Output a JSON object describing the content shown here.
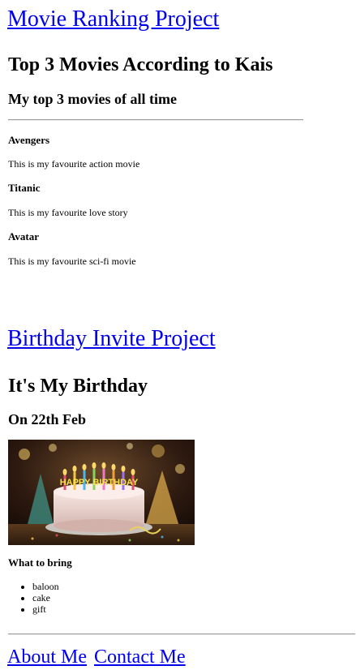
{
  "movie_project": {
    "link": "Movie Ranking Project",
    "title": "Top 3 Movies According to Kais",
    "subtitle": "My top 3 movies of all time",
    "movies": [
      {
        "name": "Avengers",
        "description": "This is my favourite action movie"
      },
      {
        "name": "Titanic",
        "description": "This is my favourite love story"
      },
      {
        "name": "Avatar",
        "description": "This is my favourite sci-fi movie"
      }
    ]
  },
  "birthday_project": {
    "link": "Birthday Invite Project",
    "title": "It's My Birthday",
    "date": "On 22th Feb",
    "image_text": "HAPPY BIRTHDAY",
    "bring_heading": "What to bring",
    "bring_items": [
      "baloon",
      "cake",
      "gift"
    ]
  },
  "footer": {
    "about": "About Me",
    "contact": "Contact Me"
  }
}
